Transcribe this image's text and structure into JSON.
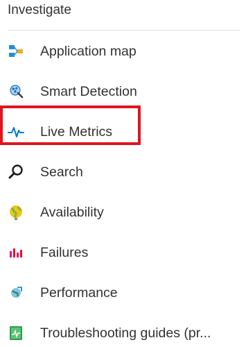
{
  "section": {
    "title": "Investigate"
  },
  "nav": {
    "items": [
      {
        "label": "Application map",
        "icon": "application-map-icon"
      },
      {
        "label": "Smart Detection",
        "icon": "smart-detection-icon"
      },
      {
        "label": "Live Metrics",
        "icon": "live-metrics-icon",
        "highlighted": true
      },
      {
        "label": "Search",
        "icon": "search-icon"
      },
      {
        "label": "Availability",
        "icon": "availability-globe-icon"
      },
      {
        "label": "Failures",
        "icon": "failures-bar-chart-icon"
      },
      {
        "label": "Performance",
        "icon": "performance-icon"
      },
      {
        "label": "Troubleshooting guides (pr...",
        "icon": "troubleshooting-guides-icon"
      }
    ]
  },
  "colors": {
    "highlight": "#e0151f",
    "text": "#323130",
    "accent_blue": "#0078d4"
  }
}
